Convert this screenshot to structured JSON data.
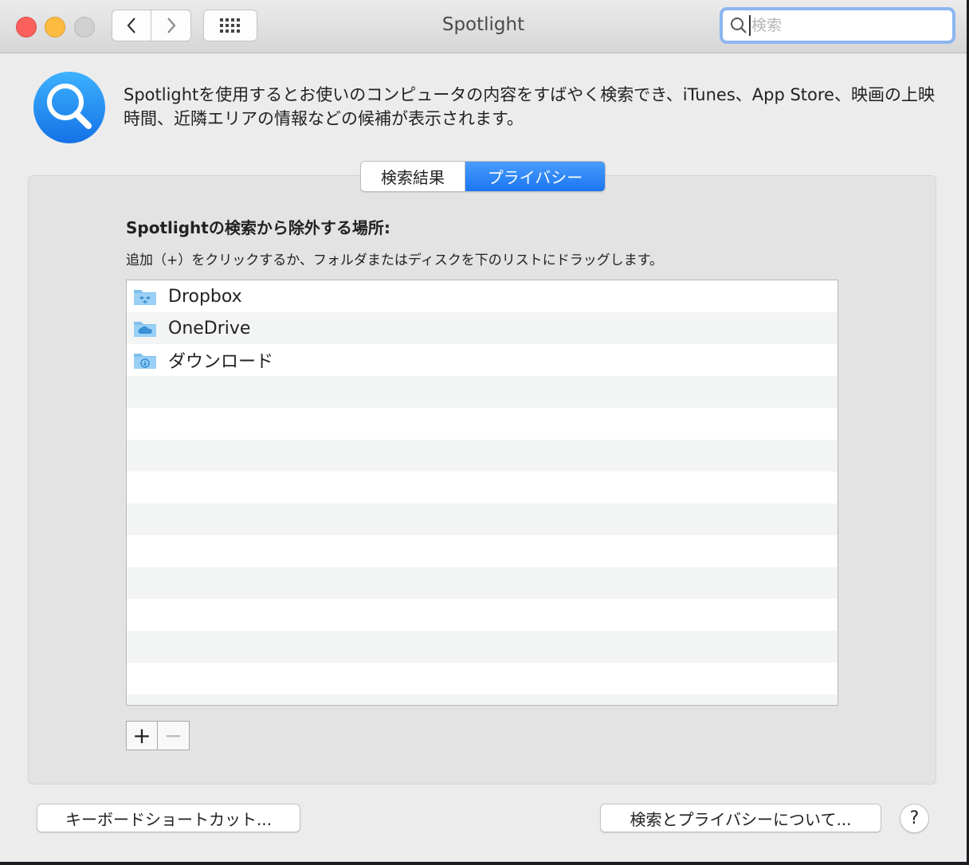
{
  "window": {
    "title": "Spotlight",
    "search_placeholder": "検索"
  },
  "header": {
    "description": "Spotlightを使用するとお使いのコンピュータの内容をすばやく検索でき、iTunes、App Store、映画の上映時間、近隣エリアの情報などの候補が表示されます。"
  },
  "tabs": [
    {
      "label": "検索結果",
      "selected": false
    },
    {
      "label": "プライバシー",
      "selected": true
    }
  ],
  "privacy": {
    "section_title": "Spotlightの検索から除外する場所:",
    "instruction": "追加（+）をクリックするか、フォルダまたはディスクを下のリストにドラッグします。",
    "items": [
      {
        "label": "Dropbox",
        "icon": "dropbox-folder-icon"
      },
      {
        "label": "OneDrive",
        "icon": "onedrive-folder-icon"
      },
      {
        "label": "ダウンロード",
        "icon": "downloads-folder-icon"
      }
    ],
    "add_label": "+",
    "remove_label": "−"
  },
  "footer": {
    "shortcuts_label": "キーボードショートカット...",
    "about_label": "検索とプライバシーについて...",
    "help_label": "?"
  },
  "colors": {
    "accent": "#1975f2",
    "folder": "#7fc0ef"
  }
}
